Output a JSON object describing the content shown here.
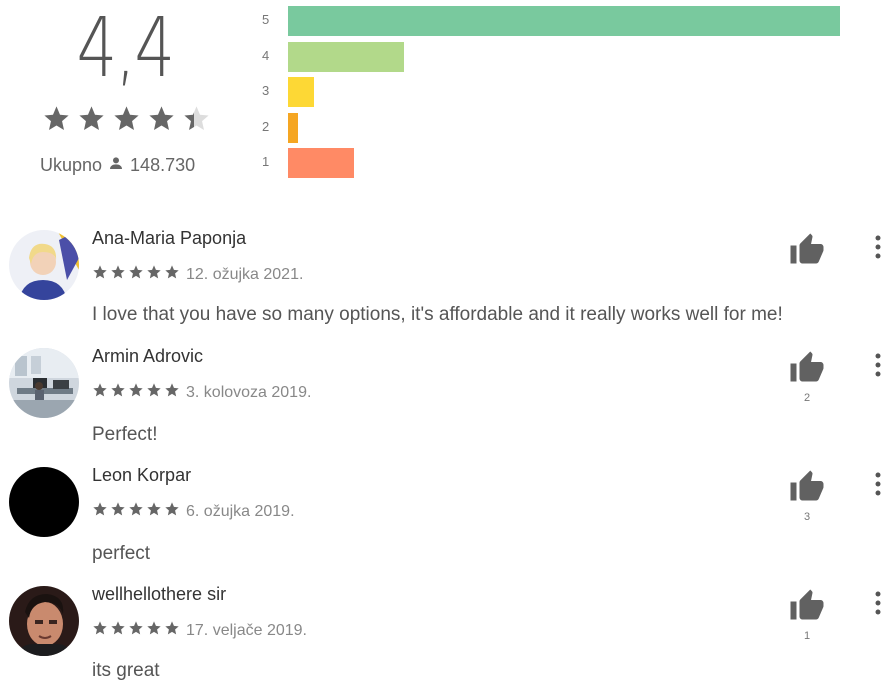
{
  "summary": {
    "score": "4,4",
    "stars": 4.4,
    "total_label": "Ukupno",
    "total_count": "148.730",
    "distribution": [
      {
        "label": "5",
        "fraction": 1.0,
        "color": "#79c99e"
      },
      {
        "label": "4",
        "fraction": 0.21,
        "color": "#b2d98a"
      },
      {
        "label": "3",
        "fraction": 0.048,
        "color": "#fdd835"
      },
      {
        "label": "2",
        "fraction": 0.018,
        "color": "#f5a623"
      },
      {
        "label": "1",
        "fraction": 0.12,
        "color": "#ff8a65"
      }
    ]
  },
  "reviews": [
    {
      "author": "Ana-Maria Paponja",
      "rating": 5,
      "date": "12. ožujka 2021.",
      "text": "I love that you have so many options, it's affordable and it really works well for me!",
      "likes": ""
    },
    {
      "author": "Armin Adrovic",
      "rating": 5,
      "date": "3. kolovoza 2019.",
      "text": "Perfect!",
      "likes": "2"
    },
    {
      "author": "Leon Korpar",
      "rating": 5,
      "date": "6. ožujka 2019.",
      "text": "perfect",
      "likes": "3"
    },
    {
      "author": "wellhellothere sir",
      "rating": 5,
      "date": "17. veljače 2019.",
      "text": "its great",
      "likes": "1"
    }
  ],
  "icons": {
    "thumb": "thumbs-up-icon",
    "more": "more-vert-icon",
    "person": "person-icon",
    "star": "star-icon"
  }
}
